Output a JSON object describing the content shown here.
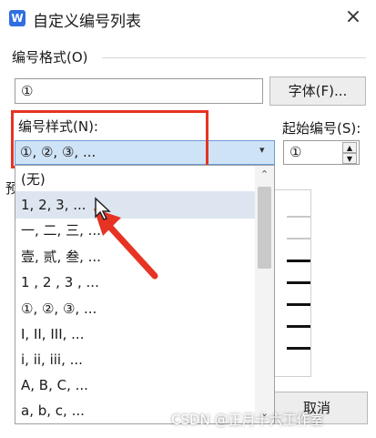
{
  "title_bar": {
    "app_icon_letter": "W",
    "title": "自定义编号列表",
    "close_glyph": "×"
  },
  "number_format": {
    "section_label": "编号格式(O)",
    "value": "①",
    "font_button": "字体(F)..."
  },
  "number_style": {
    "label": "编号样式(N):",
    "selected": "①, ②, ③, ...",
    "dropdown_arrow": "▾"
  },
  "start_number": {
    "label": "起始编号(S):",
    "value": "①",
    "up_glyph": "▲",
    "down_glyph": "▼"
  },
  "preview_label_partial": "预",
  "dropdown_items": [
    "(无)",
    "1, 2, 3, ...",
    "一, 二, 三, ...",
    "壹, 贰, 叁, ...",
    " 1 , 2 , 3 , ...",
    "①, ②, ③, ...",
    "I, II, III, ...",
    "i, ii, iii, ...",
    "A, B, C, ...",
    "a, b, c, ..."
  ],
  "highlighted_index": 1,
  "scroll": {
    "up_glyph": "⌃",
    "down_glyph": "⌄"
  },
  "cancel_button": "取消",
  "watermark": "CSDN @正月十六工作室",
  "colors": {
    "highlight_red": "#e63323",
    "selection_blue": "#cfe3f7",
    "hover_row": "#dde6f0"
  }
}
